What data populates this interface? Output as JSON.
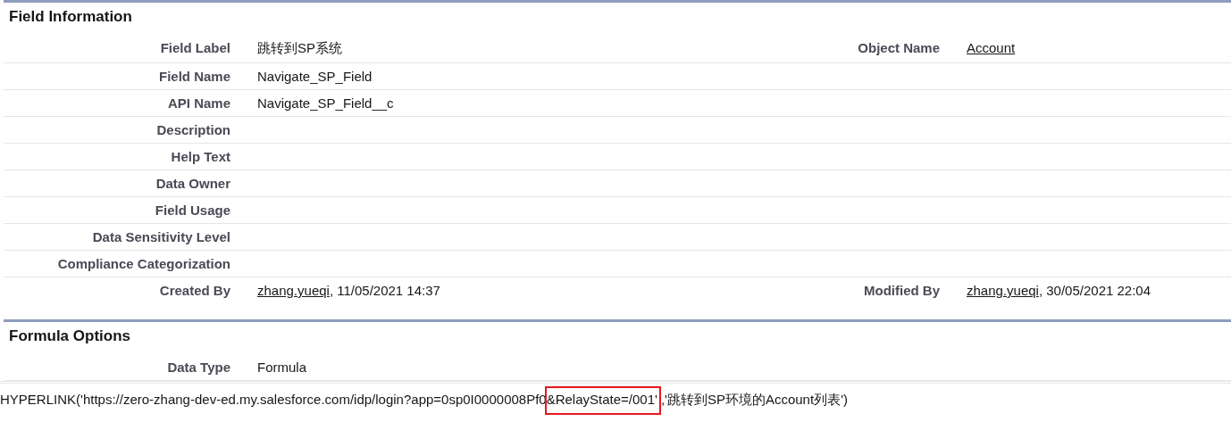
{
  "sections": [
    {
      "title": "Field Information",
      "rows": [
        {
          "label": "Field Label",
          "value": "跳转到SP系统",
          "right": {
            "label": "Object Name",
            "link": "Account"
          }
        },
        {
          "label": "Field Name",
          "value": "Navigate_SP_Field"
        },
        {
          "label": "API Name",
          "value": "Navigate_SP_Field__c"
        },
        {
          "label": "Description"
        },
        {
          "label": "Help Text"
        },
        {
          "label": "Data Owner"
        },
        {
          "label": "Field Usage"
        },
        {
          "label": "Data Sensitivity Level"
        },
        {
          "label": "Compliance Categorization"
        },
        {
          "label": "Created By",
          "link": "zhang.yueqi",
          "value": ", 11/05/2021 14:37",
          "right": {
            "label": "Modified By",
            "link": "zhang.yueqi",
            "value": ", 30/05/2021 22:04"
          }
        }
      ]
    },
    {
      "title": "Formula Options",
      "rows": [
        {
          "label": "Data Type",
          "value": "Formula"
        }
      ],
      "formula": {
        "before": "HYPERLINK('https://zero-zhang-dev-ed.my.salesforce.com/idp/login?app=0sp0I0000008Pf0",
        "highlight": "&RelayState=/001'",
        "after": ",'跳转到SP环境的Account列表')"
      }
    }
  ]
}
